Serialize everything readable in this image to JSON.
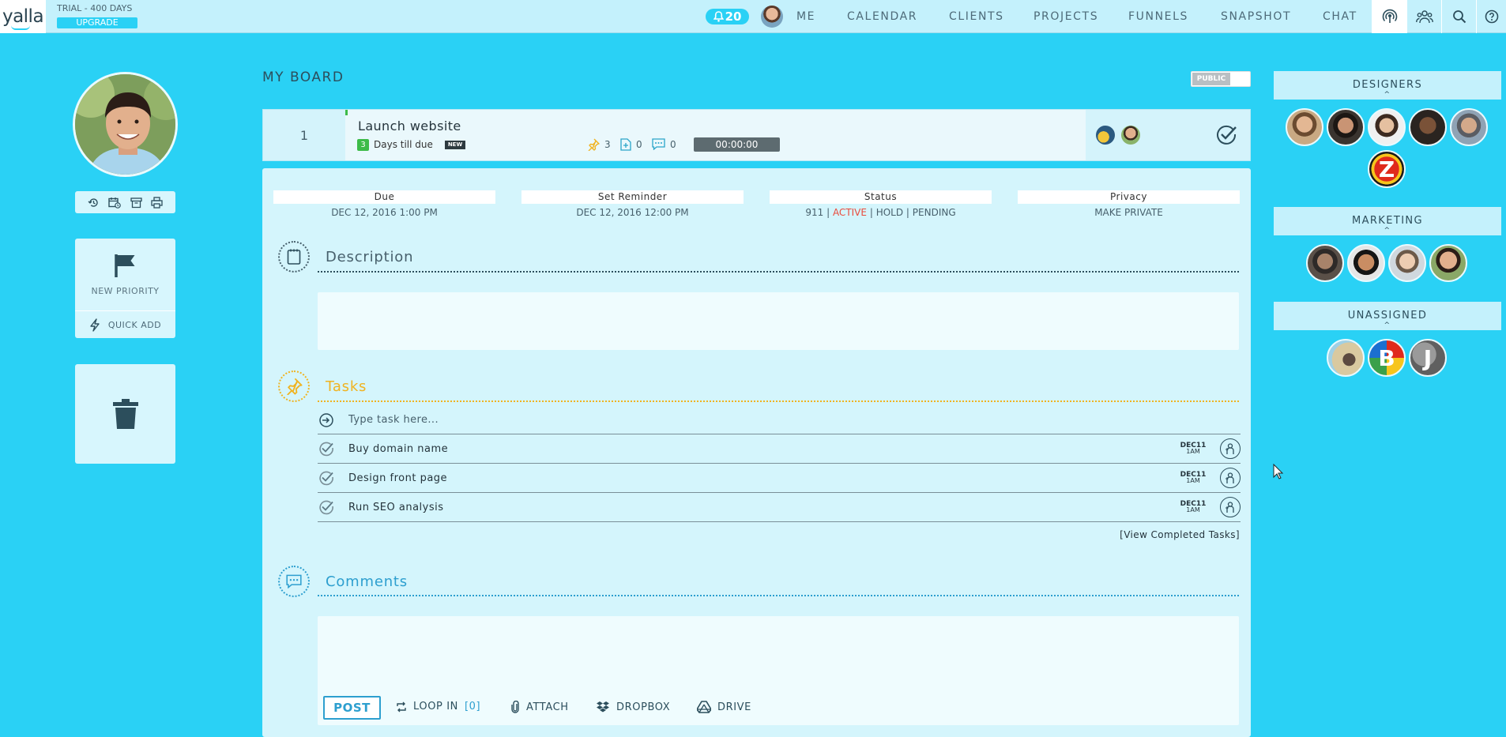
{
  "app": {
    "logo": "yalla",
    "trial": "TRIAL - 400 DAYS",
    "upgrade": "UPGRADE"
  },
  "nav": {
    "notifications": "20",
    "me": "ME",
    "calendar": "CALENDAR",
    "clients": "CLIENTS",
    "projects": "PROJECTS",
    "funnels": "FUNNELS",
    "snapshot": "SNAPSHOT",
    "chat": "CHAT"
  },
  "sidebar": {
    "new_priority": "NEW PRIORITY",
    "quick_add": "QUICK ADD"
  },
  "board": {
    "title": "MY BOARD",
    "visibility": "PUBLIC"
  },
  "card": {
    "number": "1",
    "title": "Launch website",
    "days_count": "3",
    "days_text": "Days till due",
    "new_badge": "NEW",
    "tasks_count": "3",
    "files_count": "0",
    "comments_count": "0",
    "timer": "00:00:00"
  },
  "meta": {
    "due_label": "Due",
    "due_value": "DEC 12, 2016 1:00 PM",
    "reminder_label": "Set Reminder",
    "reminder_value": "DEC 12, 2016 12:00 PM",
    "status_label": "Status",
    "status_911": "911",
    "status_active": "ACTIVE",
    "status_hold": "HOLD",
    "status_pending": "PENDING",
    "sep": "|",
    "privacy_label": "Privacy",
    "privacy_value": "MAKE PRIVATE"
  },
  "description": {
    "title": "Description"
  },
  "tasks": {
    "title": "Tasks",
    "placeholder": "Type task here...",
    "items": [
      {
        "name": "Buy domain name",
        "month": "DEC11",
        "time": "1AM"
      },
      {
        "name": "Design front page",
        "month": "DEC11",
        "time": "1AM"
      },
      {
        "name": "Run SEO analysis",
        "month": "DEC11",
        "time": "1AM"
      }
    ],
    "view_completed": "[View Completed Tasks]"
  },
  "comments": {
    "title": "Comments",
    "post": "POST",
    "loop_in": "LOOP IN",
    "loop_count": "[0]",
    "attach": "ATTACH",
    "dropbox": "DROPBOX",
    "drive": "DRIVE"
  },
  "groups": {
    "designers": "DESIGNERS",
    "marketing": "MARKETING",
    "unassigned": "UNASSIGNED",
    "letter_z": "Z",
    "letter_b": "B",
    "letter_j": "J"
  },
  "colors": {
    "background": "#2ad1f5",
    "active": "#e94b3c",
    "tasks_accent": "#f0b320",
    "comments_accent": "#2d9fcf",
    "due_green": "#3dbb48"
  }
}
